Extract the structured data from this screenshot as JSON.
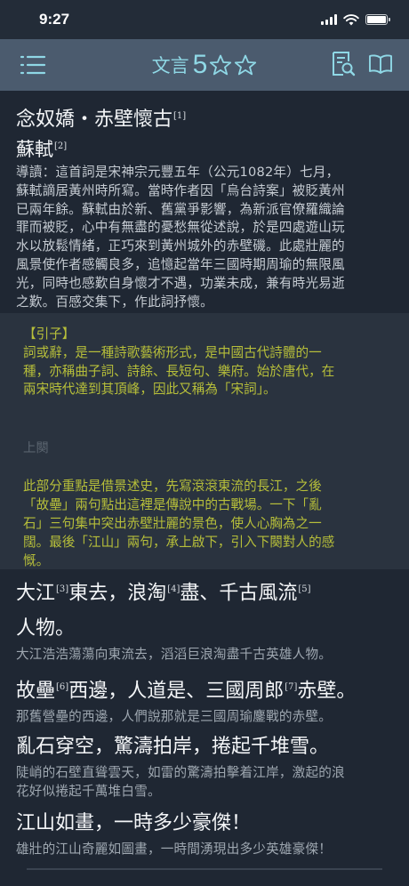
{
  "status": {
    "time": "9:27"
  },
  "nav": {
    "title_text": "文言",
    "title_number": "5",
    "stars_total": 2,
    "menu_icon": "hamburger-menu-icon",
    "search_doc_icon": "document-search-icon",
    "book_icon": "open-book-icon",
    "accent": "#8fd8e6"
  },
  "poem": {
    "title": "念奴嬌・赤壁懷古",
    "title_note": "[1]",
    "author": "蘇軾",
    "author_note": "[2]",
    "intro_lines": [
      "導讀：這首詞是宋神宗元豐五年（公元1082年）七月，",
      "蘇軾謫居黃州時所寫。當時作者因「烏台詩案」被貶黃州",
      "已兩年餘。蘇軾由於新、舊黨爭影響，為新派官僚羅織論",
      "罪而被貶，心中有無盡的憂愁無從述說，於是四處遊山玩",
      "水以放鬆情緒，正巧來到黃州城外的赤壁磯。此處壯麗的",
      "風景使作者感觸良多，追憶起當年三國時期周瑜的無限風",
      "光，同時也感歎自身懷才不遇，功業未成，兼有時光易逝",
      "之歎。百感交集下，作此詞抒懷。"
    ]
  },
  "yinzi": {
    "label": "【引子】",
    "lines": [
      "詞或辭，是一種詩歌藝術形式，是中國古代詩體的一",
      "種，亦稱曲子詞、詩餘、長短句、樂府。始於唐代，在",
      "兩宋時代達到其頂峰，因此又稱為「宋詞」。"
    ]
  },
  "shangque": {
    "label": "上闋",
    "lines": [
      "此部分重點是借景述史，先寫滾滾東流的長江，之後",
      "「故壘」兩句點出這裡是傳說中的古戰場。一下「亂",
      "石」三句集中突出赤壁壯麗的景色，使人心胸為之一",
      "闊。最後「江山」兩句，承上啟下，引入下闋對人的感",
      "慨。"
    ]
  },
  "verses": [
    {
      "line1_a": "大江",
      "note_a": "[3]",
      "line1_b": "東去，浪淘",
      "note_b": "[4]",
      "line1_c": "盡、千古風流",
      "note_c": "[5]",
      "line2": "人物。",
      "trans": [
        "大江浩浩蕩蕩向東流去，滔滔巨浪淘盡千古英雄人物。"
      ]
    },
    {
      "line1_a": "故壘",
      "note_a": "[6]",
      "line1_b": "西邊，人道是、三國周郎",
      "note_b": "[7]",
      "line1_c": "赤壁。",
      "trans": [
        "那舊營壘的西邊，人們說那就是三國周瑜鏖戰的赤壁。"
      ]
    },
    {
      "line": "亂石穿空，驚濤拍岸，捲起千堆雪。",
      "trans": [
        "陡峭的石壁直聳雲天，如雷的驚濤拍擊着江岸，激起的浪",
        "花好似捲起千萬堆白雪。"
      ]
    },
    {
      "line": "江山如畫，一時多少豪傑！",
      "trans": [
        "雄壯的江山奇麗如圖畫，一時間湧現出多少英雄豪傑！"
      ]
    }
  ]
}
